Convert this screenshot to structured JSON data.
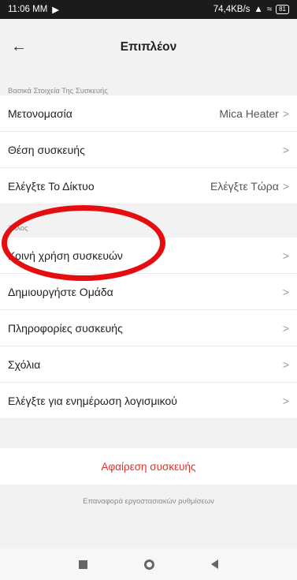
{
  "statusbar": {
    "time": "11:06 MM",
    "speed": "74,4KB/s",
    "battery": "81"
  },
  "header": {
    "title": "Επιπλέον"
  },
  "sections": [
    {
      "label": "Βασικά Στοιχεία Της Συσκευής",
      "items": [
        {
          "label": "Μετονομασία",
          "value": "Mica Heater"
        },
        {
          "label": "Θέση συσκευής",
          "value": ""
        },
        {
          "label": "Ελέγξτε Το Δίκτυο",
          "value": "Ελέγξτε Τώρα"
        }
      ]
    },
    {
      "label": "Άλλος",
      "items": [
        {
          "label": "Κοινή χρήση συσκευών"
        },
        {
          "label": "Δημιουργήστε Ομάδα"
        },
        {
          "label": "Πληροφορίες συσκευής"
        },
        {
          "label": "Σχόλια"
        },
        {
          "label": "Ελέγξτε για ενημέρωση λογισμικού"
        }
      ]
    }
  ],
  "actions": {
    "remove": "Αφαίρεση συσκευής",
    "reset": "Επαναφορά εργοστασιακών ρυθμίσεων"
  },
  "colors": {
    "annotation": "#e60d10",
    "remove": "#e0302a"
  }
}
